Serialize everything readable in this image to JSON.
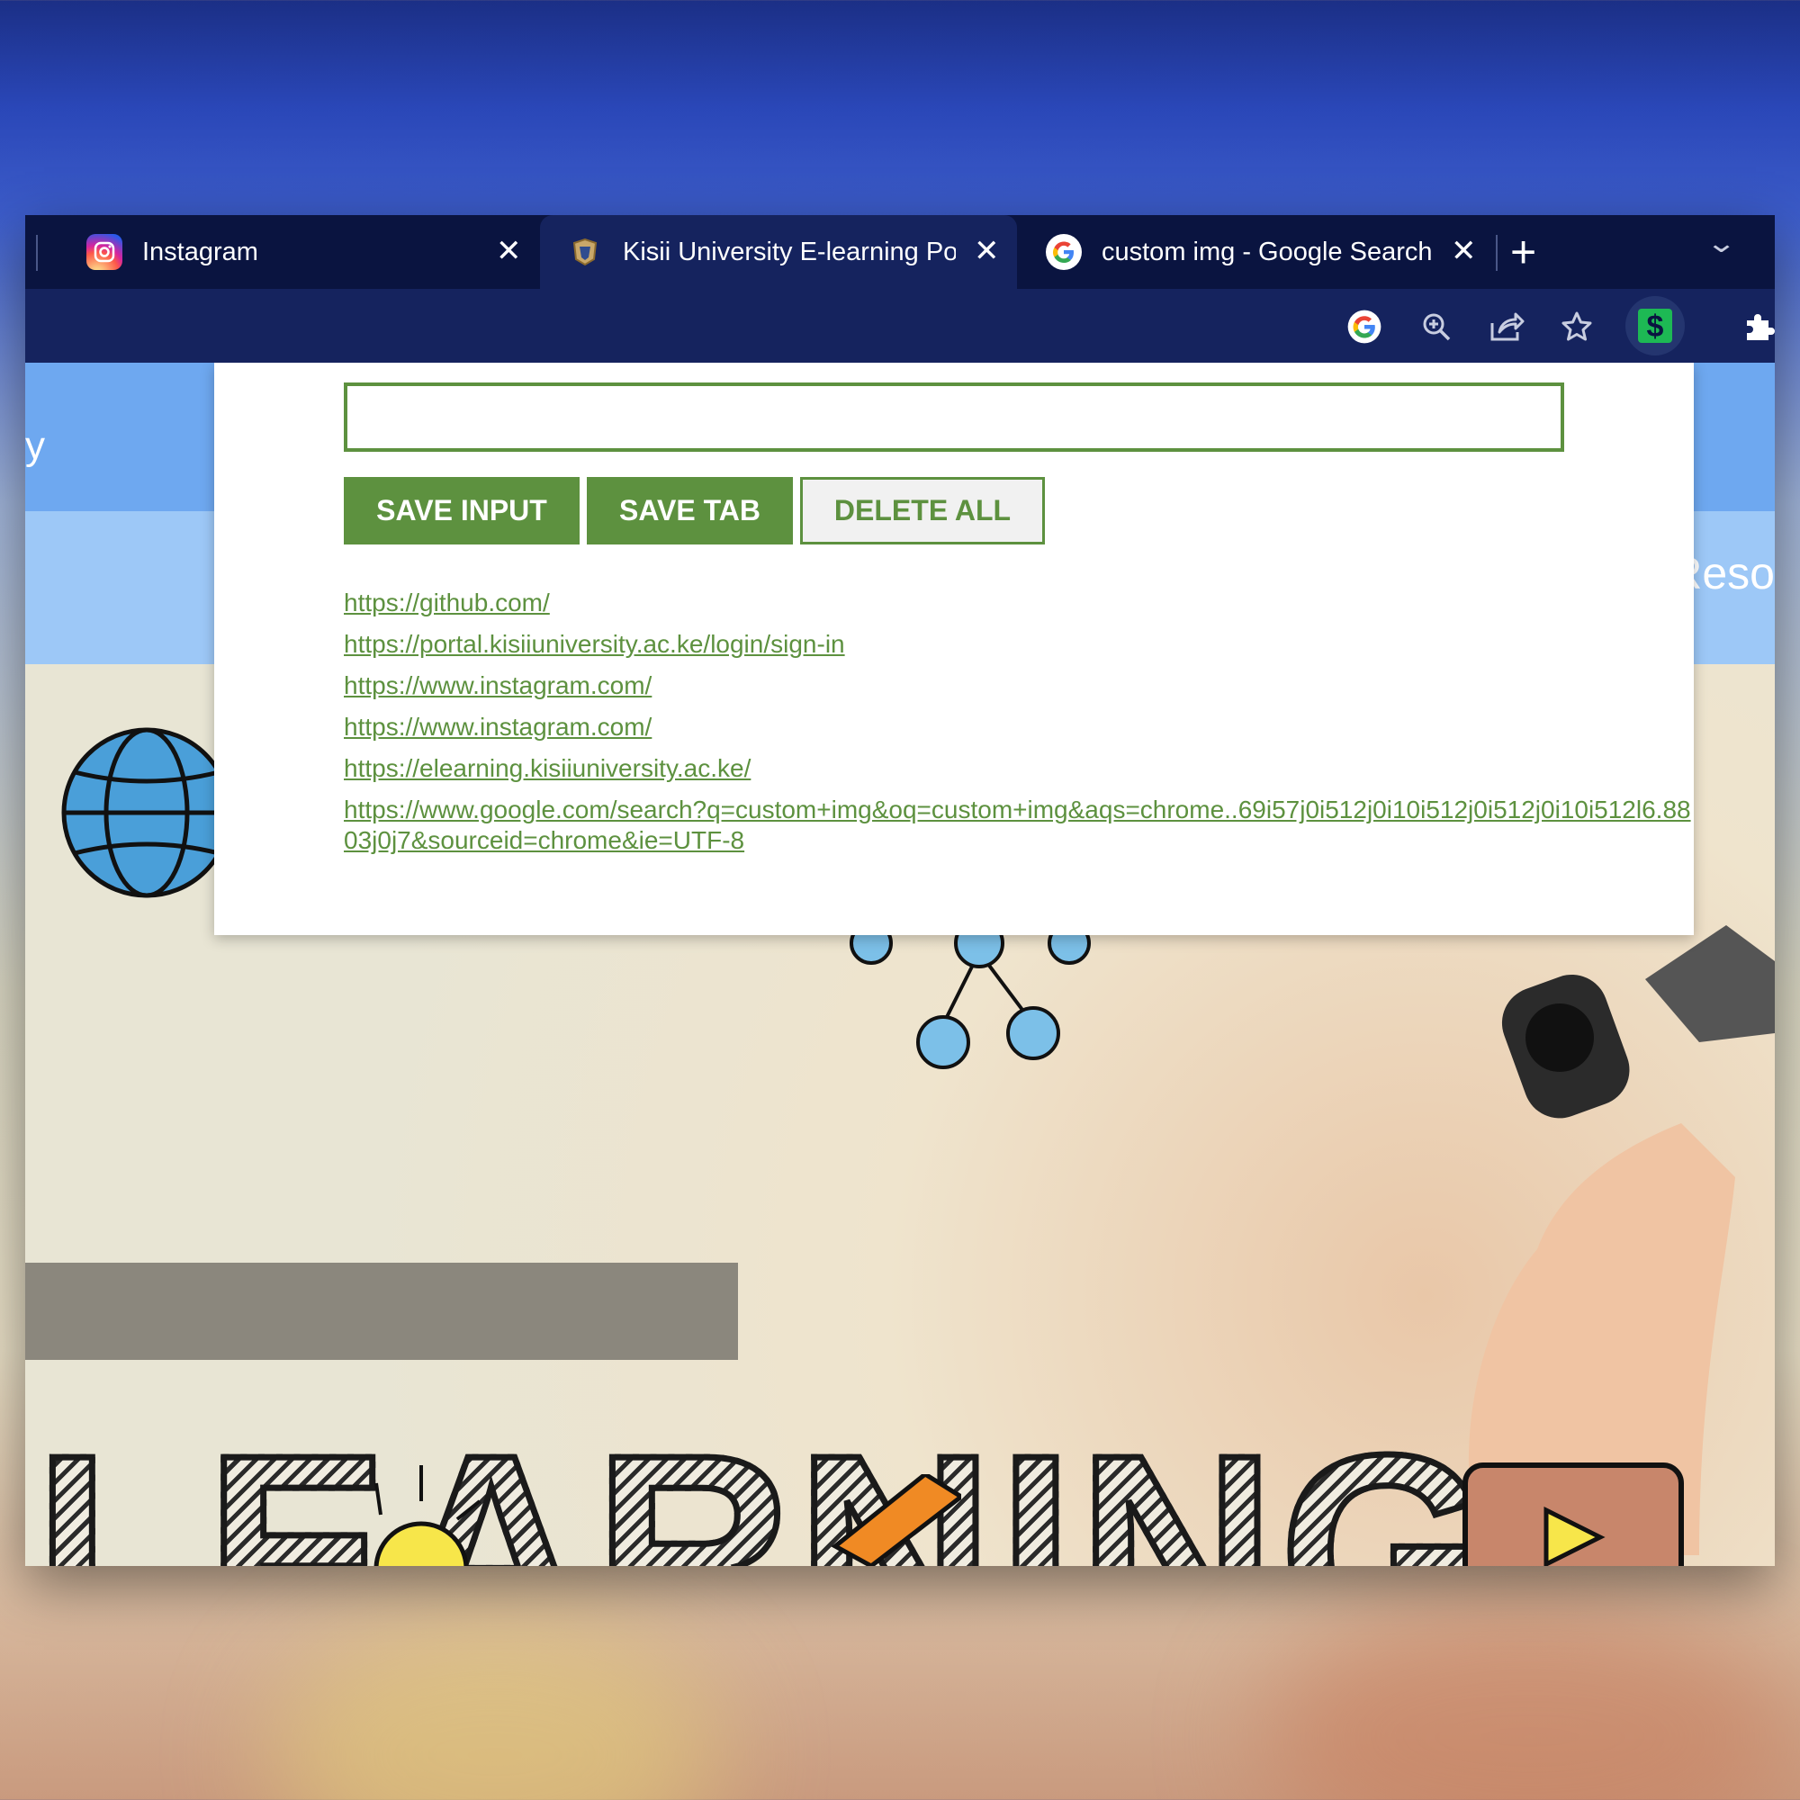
{
  "tabs": [
    {
      "title": "Instagram",
      "icon": "instagram-icon"
    },
    {
      "title": "Kisii University E-learning Por",
      "icon": "university-crest-icon",
      "active": true
    },
    {
      "title": "custom img - Google Search",
      "icon": "google-icon"
    }
  ],
  "tab_close_glyph": "✕",
  "new_tab_glyph": "+",
  "tab_menu_glyph": "⌄",
  "toolbar_icons": [
    "google-lens-icon",
    "zoom-icon",
    "share-icon",
    "bookmark-star-icon",
    "dollar-extension-icon",
    "extensions-puzzle-icon"
  ],
  "page": {
    "nav_fragment_left": "y",
    "nav_fragment_right": "Reso",
    "hero_word": "LEARNING"
  },
  "popup": {
    "input_value": "",
    "input_placeholder": "",
    "buttons": {
      "save_input": "SAVE INPUT",
      "save_tab": "SAVE TAB",
      "delete_all": "DELETE ALL"
    },
    "links": [
      "https://github.com/",
      "https://portal.kisiiuniversity.ac.ke/login/sign-in",
      "https://www.instagram.com/",
      "https://www.instagram.com/",
      "https://elearning.kisiiuniversity.ac.ke/",
      "https://www.google.com/search?q=custom+img&oq=custom+img&aqs=chrome..69i57j0i512j0i10i512j0i512j0i10i512l6.8803j0j7&sourceid=chrome&ie=UTF-8"
    ]
  },
  "colors": {
    "accent_green": "#5d913f",
    "browser_dark": "#0a1440",
    "toolbar": "#15235e"
  }
}
